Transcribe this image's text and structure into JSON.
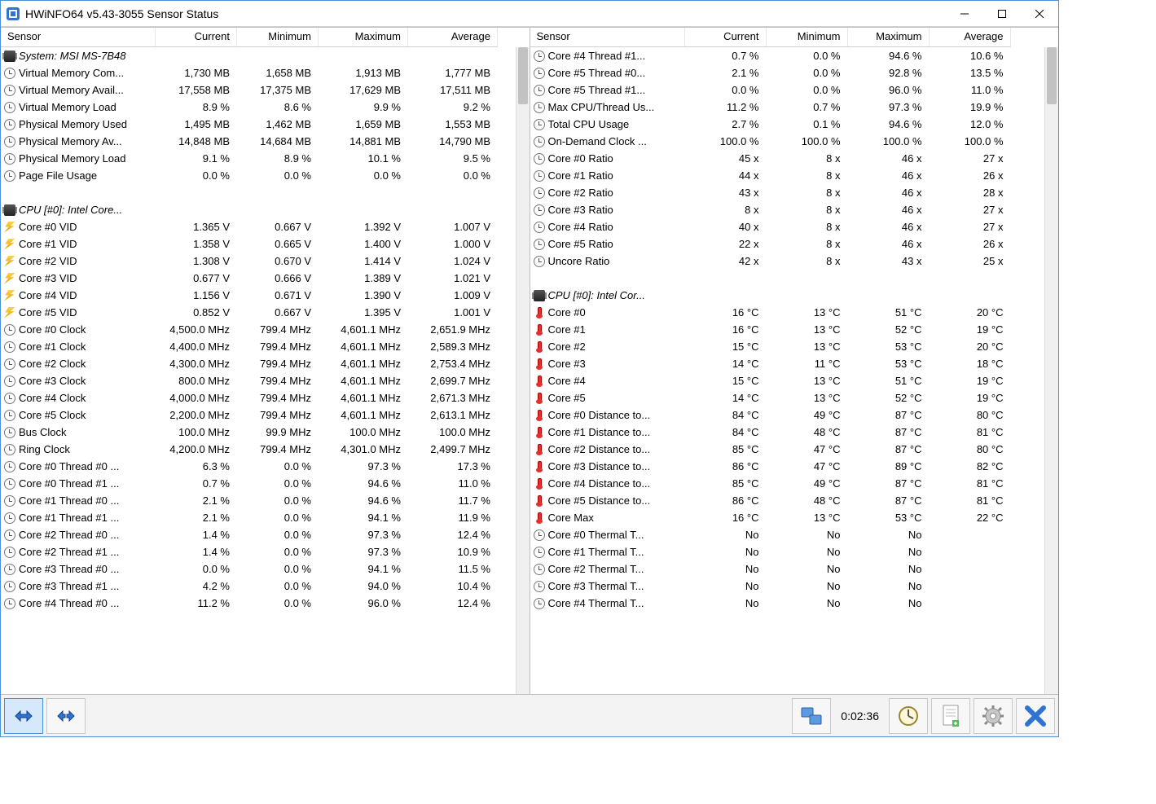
{
  "window": {
    "title": "HWiNFO64 v5.43-3055 Sensor Status"
  },
  "columns": [
    "Sensor",
    "Current",
    "Minimum",
    "Maximum",
    "Average"
  ],
  "left_rows": [
    {
      "type": "group",
      "icon": "chip",
      "label": "System: MSI MS-7B48"
    },
    {
      "icon": "clock",
      "label": "Virtual Memory Com...",
      "cur": "1,730 MB",
      "min": "1,658 MB",
      "max": "1,913 MB",
      "avg": "1,777 MB"
    },
    {
      "icon": "clock",
      "label": "Virtual Memory Avail...",
      "cur": "17,558 MB",
      "min": "17,375 MB",
      "max": "17,629 MB",
      "avg": "17,511 MB"
    },
    {
      "icon": "clock",
      "label": "Virtual Memory Load",
      "cur": "8.9 %",
      "min": "8.6 %",
      "max": "9.9 %",
      "avg": "9.2 %"
    },
    {
      "icon": "clock",
      "label": "Physical Memory Used",
      "cur": "1,495 MB",
      "min": "1,462 MB",
      "max": "1,659 MB",
      "avg": "1,553 MB"
    },
    {
      "icon": "clock",
      "label": "Physical Memory Av...",
      "cur": "14,848 MB",
      "min": "14,684 MB",
      "max": "14,881 MB",
      "avg": "14,790 MB"
    },
    {
      "icon": "clock",
      "label": "Physical Memory Load",
      "cur": "9.1 %",
      "min": "8.9 %",
      "max": "10.1 %",
      "avg": "9.5 %"
    },
    {
      "icon": "clock",
      "label": "Page File Usage",
      "cur": "0.0 %",
      "min": "0.0 %",
      "max": "0.0 %",
      "avg": "0.0 %"
    },
    {
      "type": "blank"
    },
    {
      "type": "group",
      "icon": "chip",
      "label": "CPU [#0]: Intel Core..."
    },
    {
      "icon": "bolt",
      "label": "Core #0 VID",
      "cur": "1.365 V",
      "min": "0.667 V",
      "max": "1.392 V",
      "avg": "1.007 V"
    },
    {
      "icon": "bolt",
      "label": "Core #1 VID",
      "cur": "1.358 V",
      "min": "0.665 V",
      "max": "1.400 V",
      "avg": "1.000 V"
    },
    {
      "icon": "bolt",
      "label": "Core #2 VID",
      "cur": "1.308 V",
      "min": "0.670 V",
      "max": "1.414 V",
      "avg": "1.024 V"
    },
    {
      "icon": "bolt",
      "label": "Core #3 VID",
      "cur": "0.677 V",
      "min": "0.666 V",
      "max": "1.389 V",
      "avg": "1.021 V"
    },
    {
      "icon": "bolt",
      "label": "Core #4 VID",
      "cur": "1.156 V",
      "min": "0.671 V",
      "max": "1.390 V",
      "avg": "1.009 V"
    },
    {
      "icon": "bolt",
      "label": "Core #5 VID",
      "cur": "0.852 V",
      "min": "0.667 V",
      "max": "1.395 V",
      "avg": "1.001 V"
    },
    {
      "icon": "clock",
      "label": "Core #0 Clock",
      "cur": "4,500.0 MHz",
      "min": "799.4 MHz",
      "max": "4,601.1 MHz",
      "avg": "2,651.9 MHz"
    },
    {
      "icon": "clock",
      "label": "Core #1 Clock",
      "cur": "4,400.0 MHz",
      "min": "799.4 MHz",
      "max": "4,601.1 MHz",
      "avg": "2,589.3 MHz"
    },
    {
      "icon": "clock",
      "label": "Core #2 Clock",
      "cur": "4,300.0 MHz",
      "min": "799.4 MHz",
      "max": "4,601.1 MHz",
      "avg": "2,753.4 MHz"
    },
    {
      "icon": "clock",
      "label": "Core #3 Clock",
      "cur": "800.0 MHz",
      "min": "799.4 MHz",
      "max": "4,601.1 MHz",
      "avg": "2,699.7 MHz"
    },
    {
      "icon": "clock",
      "label": "Core #4 Clock",
      "cur": "4,000.0 MHz",
      "min": "799.4 MHz",
      "max": "4,601.1 MHz",
      "avg": "2,671.3 MHz"
    },
    {
      "icon": "clock",
      "label": "Core #5 Clock",
      "cur": "2,200.0 MHz",
      "min": "799.4 MHz",
      "max": "4,601.1 MHz",
      "avg": "2,613.1 MHz"
    },
    {
      "icon": "clock",
      "label": "Bus Clock",
      "cur": "100.0 MHz",
      "min": "99.9 MHz",
      "max": "100.0 MHz",
      "avg": "100.0 MHz"
    },
    {
      "icon": "clock",
      "label": "Ring Clock",
      "cur": "4,200.0 MHz",
      "min": "799.4 MHz",
      "max": "4,301.0 MHz",
      "avg": "2,499.7 MHz"
    },
    {
      "icon": "clock",
      "label": "Core #0 Thread #0 ...",
      "cur": "6.3 %",
      "min": "0.0 %",
      "max": "97.3 %",
      "avg": "17.3 %"
    },
    {
      "icon": "clock",
      "label": "Core #0 Thread #1 ...",
      "cur": "0.7 %",
      "min": "0.0 %",
      "max": "94.6 %",
      "avg": "11.0 %"
    },
    {
      "icon": "clock",
      "label": "Core #1 Thread #0 ...",
      "cur": "2.1 %",
      "min": "0.0 %",
      "max": "94.6 %",
      "avg": "11.7 %"
    },
    {
      "icon": "clock",
      "label": "Core #1 Thread #1 ...",
      "cur": "2.1 %",
      "min": "0.0 %",
      "max": "94.1 %",
      "avg": "11.9 %"
    },
    {
      "icon": "clock",
      "label": "Core #2 Thread #0 ...",
      "cur": "1.4 %",
      "min": "0.0 %",
      "max": "97.3 %",
      "avg": "12.4 %"
    },
    {
      "icon": "clock",
      "label": "Core #2 Thread #1 ...",
      "cur": "1.4 %",
      "min": "0.0 %",
      "max": "97.3 %",
      "avg": "10.9 %"
    },
    {
      "icon": "clock",
      "label": "Core #3 Thread #0 ...",
      "cur": "0.0 %",
      "min": "0.0 %",
      "max": "94.1 %",
      "avg": "11.5 %"
    },
    {
      "icon": "clock",
      "label": "Core #3 Thread #1 ...",
      "cur": "4.2 %",
      "min": "0.0 %",
      "max": "94.0 %",
      "avg": "10.4 %"
    },
    {
      "icon": "clock",
      "label": "Core #4 Thread #0 ...",
      "cur": "11.2 %",
      "min": "0.0 %",
      "max": "96.0 %",
      "avg": "12.4 %"
    }
  ],
  "right_rows": [
    {
      "icon": "clock",
      "label": "Core #4 Thread #1...",
      "cur": "0.7 %",
      "min": "0.0 %",
      "max": "94.6 %",
      "avg": "10.6 %"
    },
    {
      "icon": "clock",
      "label": "Core #5 Thread #0...",
      "cur": "2.1 %",
      "min": "0.0 %",
      "max": "92.8 %",
      "avg": "13.5 %"
    },
    {
      "icon": "clock",
      "label": "Core #5 Thread #1...",
      "cur": "0.0 %",
      "min": "0.0 %",
      "max": "96.0 %",
      "avg": "11.0 %"
    },
    {
      "icon": "clock",
      "label": "Max CPU/Thread Us...",
      "cur": "11.2 %",
      "min": "0.7 %",
      "max": "97.3 %",
      "avg": "19.9 %"
    },
    {
      "icon": "clock",
      "label": "Total CPU Usage",
      "cur": "2.7 %",
      "min": "0.1 %",
      "max": "94.6 %",
      "avg": "12.0 %"
    },
    {
      "icon": "clock",
      "label": "On-Demand Clock ...",
      "cur": "100.0 %",
      "min": "100.0 %",
      "max": "100.0 %",
      "avg": "100.0 %"
    },
    {
      "icon": "clock",
      "label": "Core #0 Ratio",
      "cur": "45 x",
      "min": "8 x",
      "max": "46 x",
      "avg": "27 x"
    },
    {
      "icon": "clock",
      "label": "Core #1 Ratio",
      "cur": "44 x",
      "min": "8 x",
      "max": "46 x",
      "avg": "26 x"
    },
    {
      "icon": "clock",
      "label": "Core #2 Ratio",
      "cur": "43 x",
      "min": "8 x",
      "max": "46 x",
      "avg": "28 x"
    },
    {
      "icon": "clock",
      "label": "Core #3 Ratio",
      "cur": "8 x",
      "min": "8 x",
      "max": "46 x",
      "avg": "27 x"
    },
    {
      "icon": "clock",
      "label": "Core #4 Ratio",
      "cur": "40 x",
      "min": "8 x",
      "max": "46 x",
      "avg": "27 x"
    },
    {
      "icon": "clock",
      "label": "Core #5 Ratio",
      "cur": "22 x",
      "min": "8 x",
      "max": "46 x",
      "avg": "26 x"
    },
    {
      "icon": "clock",
      "label": "Uncore Ratio",
      "cur": "42 x",
      "min": "8 x",
      "max": "43 x",
      "avg": "25 x"
    },
    {
      "type": "blank"
    },
    {
      "type": "group",
      "icon": "chip",
      "label": "CPU [#0]: Intel Cor..."
    },
    {
      "icon": "therm",
      "label": "Core #0",
      "cur": "16 °C",
      "min": "13 °C",
      "max": "51 °C",
      "avg": "20 °C"
    },
    {
      "icon": "therm",
      "label": "Core #1",
      "cur": "16 °C",
      "min": "13 °C",
      "max": "52 °C",
      "avg": "19 °C"
    },
    {
      "icon": "therm",
      "label": "Core #2",
      "cur": "15 °C",
      "min": "13 °C",
      "max": "53 °C",
      "avg": "20 °C"
    },
    {
      "icon": "therm",
      "label": "Core #3",
      "cur": "14 °C",
      "min": "11 °C",
      "max": "53 °C",
      "avg": "18 °C"
    },
    {
      "icon": "therm",
      "label": "Core #4",
      "cur": "15 °C",
      "min": "13 °C",
      "max": "51 °C",
      "avg": "19 °C"
    },
    {
      "icon": "therm",
      "label": "Core #5",
      "cur": "14 °C",
      "min": "13 °C",
      "max": "52 °C",
      "avg": "19 °C"
    },
    {
      "icon": "therm",
      "label": "Core #0 Distance to...",
      "cur": "84 °C",
      "min": "49 °C",
      "max": "87 °C",
      "avg": "80 °C"
    },
    {
      "icon": "therm",
      "label": "Core #1 Distance to...",
      "cur": "84 °C",
      "min": "48 °C",
      "max": "87 °C",
      "avg": "81 °C"
    },
    {
      "icon": "therm",
      "label": "Core #2 Distance to...",
      "cur": "85 °C",
      "min": "47 °C",
      "max": "87 °C",
      "avg": "80 °C"
    },
    {
      "icon": "therm",
      "label": "Core #3 Distance to...",
      "cur": "86 °C",
      "min": "47 °C",
      "max": "89 °C",
      "avg": "82 °C"
    },
    {
      "icon": "therm",
      "label": "Core #4 Distance to...",
      "cur": "85 °C",
      "min": "49 °C",
      "max": "87 °C",
      "avg": "81 °C"
    },
    {
      "icon": "therm",
      "label": "Core #5 Distance to...",
      "cur": "86 °C",
      "min": "48 °C",
      "max": "87 °C",
      "avg": "81 °C"
    },
    {
      "icon": "therm",
      "label": "Core Max",
      "cur": "16 °C",
      "min": "13 °C",
      "max": "53 °C",
      "avg": "22 °C"
    },
    {
      "icon": "clock",
      "label": "Core #0 Thermal T...",
      "cur": "No",
      "min": "No",
      "max": "No",
      "avg": ""
    },
    {
      "icon": "clock",
      "label": "Core #1 Thermal T...",
      "cur": "No",
      "min": "No",
      "max": "No",
      "avg": ""
    },
    {
      "icon": "clock",
      "label": "Core #2 Thermal T...",
      "cur": "No",
      "min": "No",
      "max": "No",
      "avg": ""
    },
    {
      "icon": "clock",
      "label": "Core #3 Thermal T...",
      "cur": "No",
      "min": "No",
      "max": "No",
      "avg": ""
    },
    {
      "icon": "clock",
      "label": "Core #4 Thermal T...",
      "cur": "No",
      "min": "No",
      "max": "No",
      "avg": ""
    }
  ],
  "footer": {
    "elapsed": "0:02:36"
  }
}
